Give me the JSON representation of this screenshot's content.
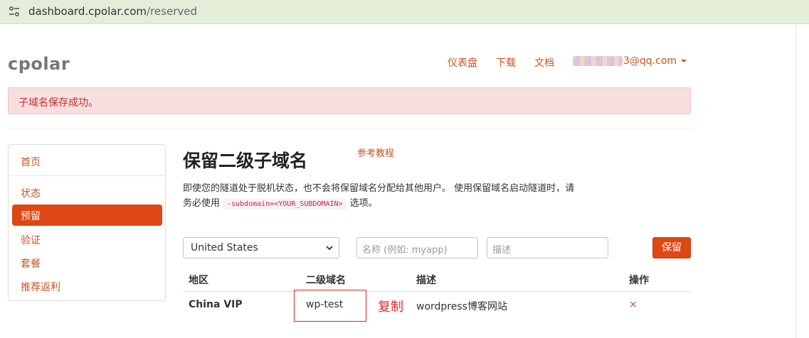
{
  "browser": {
    "url_domain": "dashboard.cpolar.com",
    "url_path": "/reserved"
  },
  "header": {
    "brand": "cpolar",
    "nav": {
      "dashboard": "仪表盘",
      "download": "下载",
      "docs": "文档",
      "user_email_visible": "3@qq.com"
    }
  },
  "alert": {
    "message": "子域名保存成功。"
  },
  "sidebar": {
    "items": [
      {
        "label": "首页"
      },
      {
        "label": "状态"
      },
      {
        "label": "预留",
        "active": true
      },
      {
        "label": "验证"
      },
      {
        "label": "套餐"
      },
      {
        "label": "推荐返利"
      }
    ]
  },
  "main": {
    "title": "保留二级子域名",
    "tutorial_link": "参考教程",
    "desc_part1": "即使您的隧道处于脱机状态，也不会将保留域名分配给其他用户。 使用保留域名启动隧道时，请务必使用",
    "desc_code": "-subdomain=<YOUR_SUBDOMAIN>",
    "desc_part2": "选项。"
  },
  "form": {
    "region_selected": "United States",
    "name_placeholder": "名称 (例如: myapp)",
    "desc_placeholder": "描述",
    "submit_label": "保留"
  },
  "table": {
    "headers": {
      "region": "地区",
      "subdomain": "二级域名",
      "description": "描述",
      "action": "操作"
    },
    "rows": [
      {
        "region": "China VIP",
        "subdomain": "wp-test",
        "description": "wordpress博客网站",
        "action": "×"
      }
    ]
  },
  "annotation": {
    "copy_label": "复制"
  }
}
